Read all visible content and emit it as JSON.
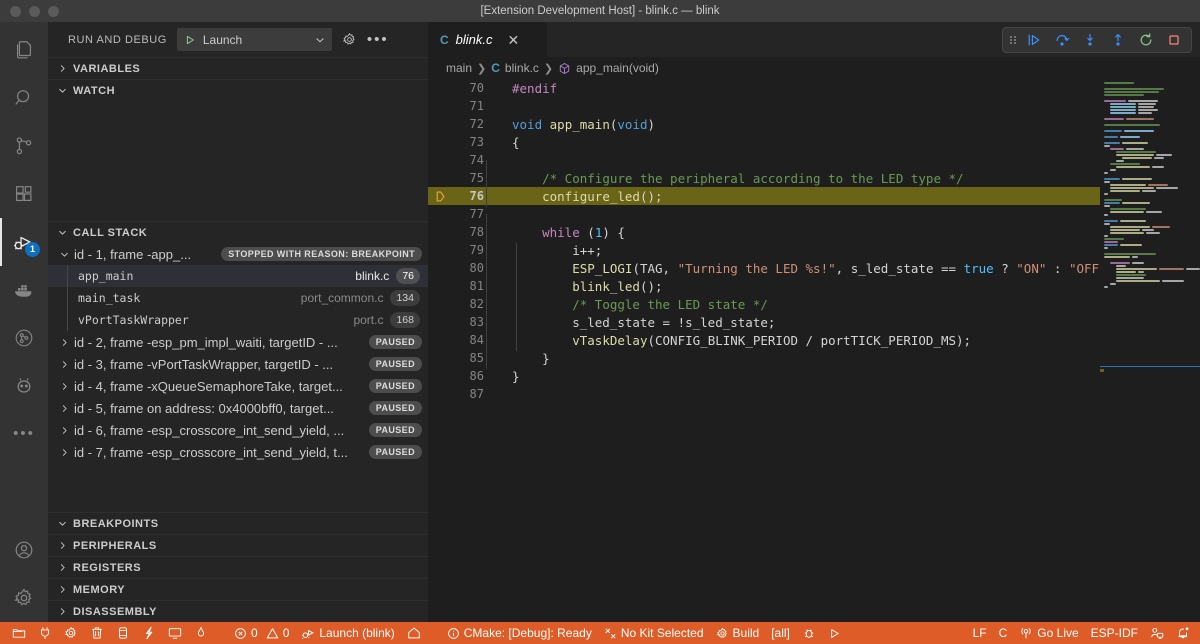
{
  "window": {
    "title": "[Extension Development Host] - blink.c — blink",
    "traffic_lights": [
      "close",
      "minimize",
      "zoom"
    ]
  },
  "activity_bar": {
    "items": [
      {
        "name": "explorer",
        "icon": "files-icon",
        "active": false
      },
      {
        "name": "search",
        "icon": "search-icon",
        "active": false
      },
      {
        "name": "source-control",
        "icon": "source-control-icon",
        "active": false
      },
      {
        "name": "extensions",
        "icon": "extensions-icon",
        "active": false
      },
      {
        "name": "run-and-debug",
        "icon": "debug-icon",
        "active": true,
        "badge": "1"
      },
      {
        "name": "docker",
        "icon": "docker-icon",
        "active": false
      },
      {
        "name": "gitlens",
        "icon": "gitlens-icon",
        "active": false
      },
      {
        "name": "platformio",
        "icon": "platformio-icon",
        "active": false
      },
      {
        "name": "more-views",
        "icon": "ellipsis-icon",
        "active": false
      }
    ],
    "bottom_items": [
      {
        "name": "accounts",
        "icon": "account-icon"
      },
      {
        "name": "manage",
        "icon": "gear-icon"
      }
    ]
  },
  "sidebar": {
    "title": "RUN AND DEBUG",
    "launch_config": {
      "label": "Launch",
      "play_icon": "play-icon",
      "chevron_icon": "chevron-down-icon"
    },
    "header_actions": [
      {
        "name": "open-launch-json",
        "icon": "gear-icon"
      },
      {
        "name": "more-actions",
        "icon": "ellipsis-icon"
      }
    ],
    "sections": [
      {
        "name": "variables",
        "label": "VARIABLES",
        "expanded": false
      },
      {
        "name": "watch",
        "label": "WATCH",
        "expanded": true
      },
      {
        "name": "call-stack",
        "label": "CALL STACK",
        "expanded": true
      }
    ],
    "bottom_sections": [
      {
        "name": "breakpoints",
        "label": "BREAKPOINTS",
        "expanded": true
      },
      {
        "name": "peripherals",
        "label": "PERIPHERALS",
        "expanded": false
      },
      {
        "name": "registers",
        "label": "REGISTERS",
        "expanded": false
      },
      {
        "name": "memory",
        "label": "MEMORY",
        "expanded": false
      },
      {
        "name": "disassembly",
        "label": "DISASSEMBLY",
        "expanded": false
      }
    ],
    "call_stack": {
      "threads": [
        {
          "label": "id - 1, frame -app_...",
          "status": "STOPPED WITH REASON: BREAKPOINT",
          "expanded": true,
          "frames": [
            {
              "name": "app_main",
              "source": "blink.c",
              "line": "76",
              "selected": true
            },
            {
              "name": "main_task",
              "source": "port_common.c",
              "line": "134",
              "selected": false
            },
            {
              "name": "vPortTaskWrapper",
              "source": "port.c",
              "line": "168",
              "selected": false
            }
          ]
        },
        {
          "label": "id - 2, frame -esp_pm_impl_waiti, targetID - ...",
          "status": "PAUSED",
          "expanded": false,
          "frames": []
        },
        {
          "label": "id - 3, frame -vPortTaskWrapper, targetID - ...",
          "status": "PAUSED",
          "expanded": false,
          "frames": []
        },
        {
          "label": "id - 4, frame -xQueueSemaphoreTake, target...",
          "status": "PAUSED",
          "expanded": false,
          "frames": []
        },
        {
          "label": "id - 5, frame on address: 0x4000bff0, target...",
          "status": "PAUSED",
          "expanded": false,
          "frames": []
        },
        {
          "label": "id - 6, frame -esp_crosscore_int_send_yield, ...",
          "status": "PAUSED",
          "expanded": false,
          "frames": []
        },
        {
          "label": "id - 7, frame -esp_crosscore_int_send_yield, t...",
          "status": "PAUSED",
          "expanded": false,
          "frames": []
        }
      ]
    }
  },
  "editor": {
    "tab": {
      "label": "blink.c",
      "file_icon": "c-file-icon",
      "close_icon": "close-icon",
      "active": true
    },
    "breadcrumbs": [
      {
        "label": "main",
        "icon": null
      },
      {
        "label": "blink.c",
        "icon": "c-file-icon"
      },
      {
        "label": "app_main(void)",
        "icon": "symbol-method-icon"
      }
    ],
    "debug_toolbar": [
      {
        "name": "drag-handle",
        "icon": "grip-icon"
      },
      {
        "name": "continue",
        "icon": "continue-icon"
      },
      {
        "name": "step-over",
        "icon": "step-over-icon"
      },
      {
        "name": "step-into",
        "icon": "step-into-icon"
      },
      {
        "name": "step-out",
        "icon": "step-out-icon"
      },
      {
        "name": "restart",
        "icon": "restart-icon"
      },
      {
        "name": "stop",
        "icon": "stop-icon"
      }
    ],
    "current_line": 76,
    "first_line": 70,
    "lines": [
      {
        "num": 70,
        "tokens": [
          {
            "t": "    ",
            "c": "t-plain"
          },
          {
            "t": "#endif",
            "c": "t-pre"
          }
        ]
      },
      {
        "num": 71,
        "tokens": []
      },
      {
        "num": 72,
        "tokens": [
          {
            "t": "void",
            "c": "t-type"
          },
          {
            "t": " ",
            "c": "t-plain"
          },
          {
            "t": "app_main",
            "c": "t-fn"
          },
          {
            "t": "(",
            "c": "t-plain"
          },
          {
            "t": "void",
            "c": "t-type"
          },
          {
            "t": ")",
            "c": "t-plain"
          }
        ]
      },
      {
        "num": 73,
        "tokens": [
          {
            "t": "{",
            "c": "t-plain"
          }
        ]
      },
      {
        "num": 74,
        "tokens": []
      },
      {
        "num": 75,
        "tokens": [
          {
            "t": "    ",
            "c": "t-plain"
          },
          {
            "t": "/* Configure the peripheral according to the LED type */",
            "c": "t-cmt"
          }
        ]
      },
      {
        "num": 76,
        "tokens": [
          {
            "t": "    ",
            "c": "t-plain"
          },
          {
            "t": "configure_led",
            "c": "t-fn"
          },
          {
            "t": "();",
            "c": "t-plain"
          }
        ]
      },
      {
        "num": 77,
        "tokens": []
      },
      {
        "num": 78,
        "tokens": [
          {
            "t": "    ",
            "c": "t-plain"
          },
          {
            "t": "while",
            "c": "t-key"
          },
          {
            "t": " (",
            "c": "t-plain"
          },
          {
            "t": "1",
            "c": "t-const"
          },
          {
            "t": ") {",
            "c": "t-plain"
          }
        ]
      },
      {
        "num": 79,
        "tokens": [
          {
            "t": "        ",
            "c": "t-plain"
          },
          {
            "t": "i++;",
            "c": "t-plain"
          }
        ]
      },
      {
        "num": 80,
        "tokens": [
          {
            "t": "        ",
            "c": "t-plain"
          },
          {
            "t": "ESP_LOGI",
            "c": "t-fn"
          },
          {
            "t": "(TAG, ",
            "c": "t-plain"
          },
          {
            "t": "\"Turning the LED %s!\"",
            "c": "t-str"
          },
          {
            "t": ", s_led_state == ",
            "c": "t-plain"
          },
          {
            "t": "true",
            "c": "t-const"
          },
          {
            "t": " ? ",
            "c": "t-plain"
          },
          {
            "t": "\"ON\"",
            "c": "t-str"
          },
          {
            "t": " : ",
            "c": "t-plain"
          },
          {
            "t": "\"OFF\"",
            "c": "t-str"
          },
          {
            "t": ");",
            "c": "t-plain"
          }
        ]
      },
      {
        "num": 81,
        "tokens": [
          {
            "t": "        ",
            "c": "t-plain"
          },
          {
            "t": "blink_led",
            "c": "t-fn"
          },
          {
            "t": "();",
            "c": "t-plain"
          }
        ]
      },
      {
        "num": 82,
        "tokens": [
          {
            "t": "        ",
            "c": "t-plain"
          },
          {
            "t": "/* Toggle the LED state */",
            "c": "t-cmt"
          }
        ]
      },
      {
        "num": 83,
        "tokens": [
          {
            "t": "        ",
            "c": "t-plain"
          },
          {
            "t": "s_led_state = !s_led_state;",
            "c": "t-plain"
          }
        ]
      },
      {
        "num": 84,
        "tokens": [
          {
            "t": "        ",
            "c": "t-plain"
          },
          {
            "t": "vTaskDelay",
            "c": "t-fn"
          },
          {
            "t": "(CONFIG_BLINK_PERIOD / portTICK_PERIOD_MS);",
            "c": "t-plain"
          }
        ]
      },
      {
        "num": 85,
        "tokens": [
          {
            "t": "    }",
            "c": "t-plain"
          }
        ]
      },
      {
        "num": 86,
        "tokens": [
          {
            "t": "}",
            "c": "t-plain"
          }
        ]
      },
      {
        "num": 87,
        "tokens": []
      }
    ]
  },
  "status_bar": {
    "background": "#dd5c27",
    "left_items": [
      {
        "name": "esp-idf-open-folder",
        "icon": "folder-icon",
        "label": ""
      },
      {
        "name": "esp-idf-select-port",
        "icon": "plug-icon",
        "label": ""
      },
      {
        "name": "esp-idf-menuconfig",
        "icon": "gear-icon",
        "label": ""
      },
      {
        "name": "esp-idf-full-clean",
        "icon": "trash-icon",
        "label": ""
      },
      {
        "name": "esp-idf-flash-device",
        "icon": "chip-icon",
        "label": ""
      },
      {
        "name": "esp-idf-build-flash-monitor",
        "icon": "zap-icon",
        "label": ""
      },
      {
        "name": "esp-idf-monitor",
        "icon": "monitor-icon",
        "label": ""
      },
      {
        "name": "esp-idf-burn",
        "icon": "flame-icon",
        "label": ""
      },
      {
        "name": "problems",
        "icon": "error-warning-icon",
        "label": "0  0",
        "errors": "0",
        "warnings": "0"
      },
      {
        "name": "debug-launch",
        "icon": "debug-alt-icon",
        "label": "Launch (blink)"
      },
      {
        "name": "esp-idf-home",
        "icon": "home-icon",
        "label": ""
      },
      {
        "name": "cmake-status",
        "icon": "info-icon",
        "label": "CMake: [Debug]: Ready"
      },
      {
        "name": "cmake-kit",
        "icon": "tools-icon",
        "label": "No Kit Selected"
      },
      {
        "name": "cmake-build",
        "icon": "gear-icon",
        "label": "Build"
      },
      {
        "name": "cmake-target",
        "icon": null,
        "label": "[all]"
      },
      {
        "name": "cmake-debug",
        "icon": "bug-icon",
        "label": ""
      },
      {
        "name": "cmake-run",
        "icon": "play-icon",
        "label": ""
      }
    ],
    "right_items": [
      {
        "name": "eol-mode",
        "icon": null,
        "label": "LF"
      },
      {
        "name": "language-mode",
        "icon": null,
        "label": "C"
      },
      {
        "name": "go-live",
        "icon": "broadcast-icon",
        "label": "Go Live"
      },
      {
        "name": "esp-idf-label",
        "icon": null,
        "label": "ESP-IDF"
      },
      {
        "name": "live-share",
        "icon": "live-share-icon",
        "label": ""
      },
      {
        "name": "notifications",
        "icon": "bell-dot-icon",
        "label": ""
      }
    ]
  }
}
